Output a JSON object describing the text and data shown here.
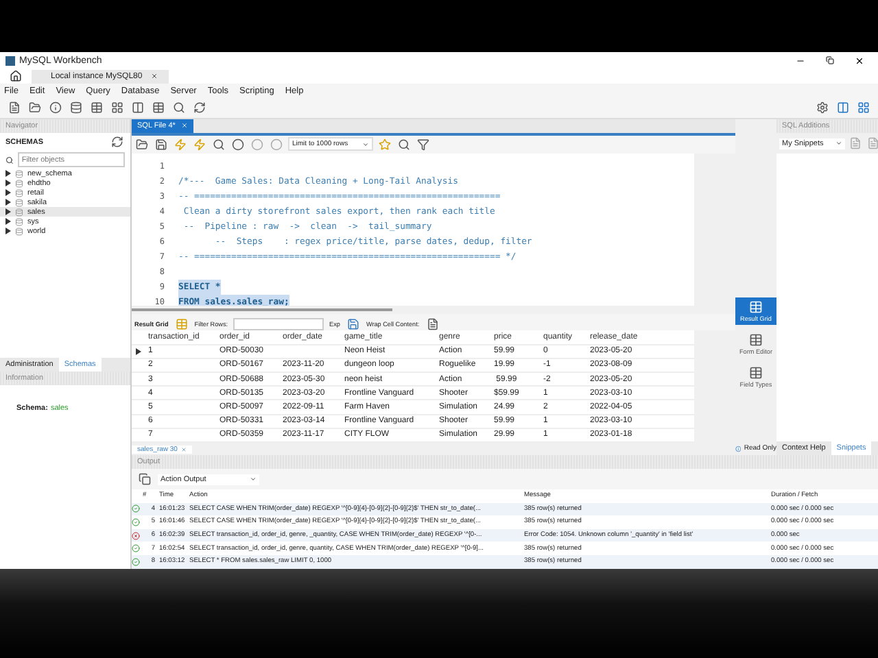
{
  "window": {
    "title": "MySQL Workbench"
  },
  "connection_tab": {
    "label": "Local instance MySQL80"
  },
  "menu": [
    "File",
    "Edit",
    "View",
    "Query",
    "Database",
    "Server",
    "Tools",
    "Scripting",
    "Help"
  ],
  "navigator": {
    "title": "Navigator",
    "schemas_label": "SCHEMAS",
    "filter_placeholder": "Filter objects",
    "schemas": [
      {
        "name": "new_schema",
        "selected": false
      },
      {
        "name": "ehdtho",
        "selected": false
      },
      {
        "name": "retail",
        "selected": false
      },
      {
        "name": "sakila",
        "selected": false
      },
      {
        "name": "sales",
        "selected": true
      },
      {
        "name": "sys",
        "selected": false
      },
      {
        "name": "world",
        "selected": false
      }
    ],
    "tabs": [
      {
        "label": "Administration",
        "selected": false
      },
      {
        "label": "Schemas",
        "selected": true
      }
    ],
    "information": {
      "title": "Information",
      "label": "Schema:",
      "value": "sales"
    }
  },
  "editor": {
    "tab": "SQL File 4*",
    "limit": "Limit to 1000 rows",
    "lines": [
      {
        "number": "1",
        "selected": false
      },
      {
        "number": "2",
        "text": "/*---  Game Sales: Data Cleaning + Long-Tail Analysis",
        "kind": "comment",
        "selected": false
      },
      {
        "number": "3",
        "text": "-- ==========================================================",
        "kind": "comment",
        "selected": false
      },
      {
        "number": "4",
        "text": " Clean a dirty storefront sales export, then rank each title",
        "kind": "comment",
        "selected": false
      },
      {
        "number": "5",
        "text": " --  Pipeline : raw  ->  clean  ->  tail_summary",
        "kind": "comment",
        "selected": false
      },
      {
        "number": "6",
        "text": "       --  Steps    : regex price/title, parse dates, dedup, filter",
        "kind": "comment",
        "selected": false
      },
      {
        "number": "7",
        "text": "-- ========================================================== */",
        "kind": "comment",
        "selected": false
      },
      {
        "number": "8",
        "selected": false
      },
      {
        "number": "9",
        "text": "SELECT *",
        "kind": "code",
        "selected": true
      },
      {
        "number": "10",
        "text": "FROM sales.sales_raw;",
        "kind": "code",
        "selected": true
      }
    ]
  },
  "result": {
    "toolbar": {
      "grid": "Result Grid",
      "filter": "Filter Rows:",
      "export": "Exp",
      "wrap": "Wrap Cell Content:"
    },
    "columns": [
      "transaction_id",
      "order_id",
      "order_date",
      "game_title",
      "genre",
      "price",
      "quantity",
      "release_date"
    ],
    "rows": [
      {
        "current": true,
        "cells": [
          "1",
          "ORD-50030",
          null,
          "Neon Heist",
          "Action",
          "59.99",
          "0",
          "2023-05-20"
        ]
      },
      {
        "current": false,
        "cells": [
          "2",
          "ORD-50167",
          "2023-11-20",
          "dungeon loop",
          "Roguelike",
          "19.99",
          "-1",
          "2023-08-09"
        ]
      },
      {
        "current": false,
        "cells": [
          "3",
          "ORD-50688",
          "2023-05-30",
          "neon heist",
          "Action",
          " 59.99",
          "-2",
          "2023-05-20"
        ]
      },
      {
        "current": false,
        "cells": [
          "4",
          "ORD-50135",
          "2023-03-20",
          "Frontline Vanguard",
          "Shooter",
          "$59.99",
          "1",
          "2023-03-10"
        ]
      },
      {
        "current": false,
        "cells": [
          "5",
          "ORD-50097",
          "2022-09-11",
          "Farm Haven",
          "Simulation",
          "24.99",
          "2",
          "2022-04-05"
        ]
      },
      {
        "current": false,
        "cells": [
          "6",
          "ORD-50331",
          "2023-03-14",
          "Frontline Vanguard",
          "Shooter",
          "59.99",
          "1",
          "2023-03-10"
        ]
      },
      {
        "current": false,
        "cells": [
          "7",
          "ORD-50359",
          "2023-11-17",
          "CITY FLOW",
          "Simulation",
          "29.99",
          "1",
          "2023-01-18"
        ]
      }
    ],
    "tab": "sales_raw 30",
    "side_buttons": [
      {
        "label": "Result Grid",
        "selected": true
      },
      {
        "label": "Form Editor",
        "selected": false
      },
      {
        "label": "Field Types",
        "selected": false
      }
    ],
    "status": "Read Only"
  },
  "additions": {
    "title": "SQL Additions",
    "snippets": "My Snippets",
    "tabs": [
      {
        "label": "Context Help",
        "selected": false
      },
      {
        "label": "Snippets",
        "selected": true
      }
    ]
  },
  "output": {
    "title": "Output",
    "mode": "Action Output",
    "columns": [
      "#",
      "Time",
      "Action",
      "Message",
      "Duration / Fetch"
    ],
    "rows": [
      {
        "kind": "ok",
        "num": "4",
        "time": "16:01:23",
        "action": "SELECT  CASE  WHEN TRIM(order_date) REGEXP '^[0-9]{4}-[0-9]{2}-[0-9]{2}$' THEN str_to_date(...",
        "message": "385 row(s) returned",
        "duration": "0.000 sec / 0.000 sec"
      },
      {
        "kind": "ok",
        "num": "5",
        "time": "16:01:46",
        "action": "SELECT  CASE  WHEN TRIM(order_date) REGEXP '^[0-9]{4}-[0-9]{2}-[0-9]{2}$' THEN str_to_date(...",
        "message": "385 row(s) returned",
        "duration": "0.000 sec / 0.000 sec"
      },
      {
        "kind": "error",
        "num": "6",
        "time": "16:02:39",
        "action": "SELECT  transaction_id, order_id, genre, _quantity,  CASE  WHEN TRIM(order_date) REGEXP '^[0-...",
        "message": "Error Code: 1054. Unknown column '_quantity' in 'field list'",
        "duration": "0.000 sec"
      },
      {
        "kind": "ok",
        "num": "7",
        "time": "16:02:54",
        "action": "SELECT  transaction_id, order_id, genre, quantity,  CASE  WHEN TRIM(order_date) REGEXP '^[0-9]...",
        "message": "385 row(s) returned",
        "duration": "0.000 sec / 0.000 sec"
      },
      {
        "kind": "ok",
        "num": "8",
        "time": "16:03:12",
        "action": "SELECT * FROM sales.sales_raw LIMIT 0, 1000",
        "message": "385 row(s) returned",
        "duration": "0.000 sec / 0.000 sec"
      }
    ]
  }
}
